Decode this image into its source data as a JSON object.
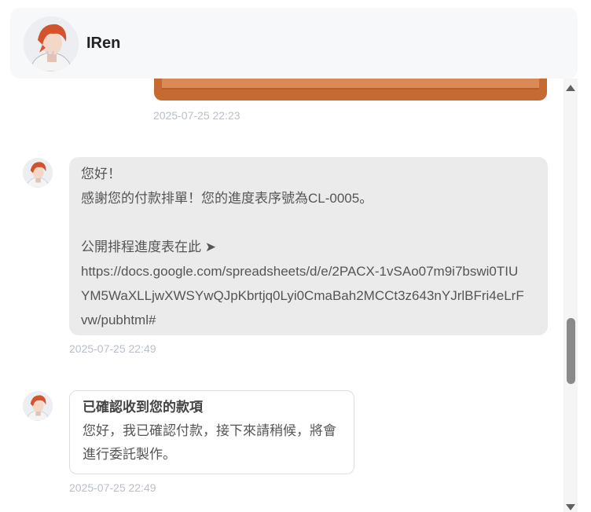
{
  "header": {
    "name": "IRen"
  },
  "messages": [
    {
      "timestamp": "2025-07-25 22:23"
    },
    {
      "lines": [
        "您好！",
        "感謝您的付款排單！您的進度表序號為CL-0005。",
        "",
        "公開排程進度表在此 ➤",
        "https://docs.google.com/spreadsheets/d/e/2PACX-1vSAo07m9i7bswi0TIU",
        "YM5WaXLLjwXWSYwQJpKbrtjq0Lyi0CmaBah2MCCt3z643nYJrlBFri4eLrF",
        "vw/pubhtml#"
      ],
      "timestamp": "2025-07-25 22:49"
    },
    {
      "title": "已確認收到您的款項",
      "lines": [
        "您好，我已確認付款，接下來請稍候，將會",
        "進行委託製作。"
      ],
      "timestamp": "2025-07-25 22:49"
    }
  ]
}
